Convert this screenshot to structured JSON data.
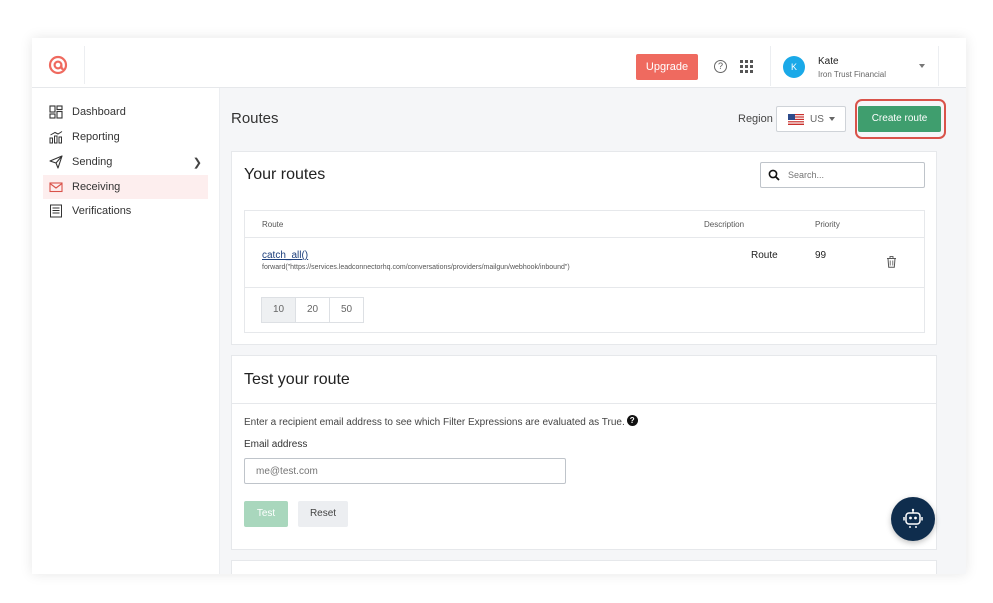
{
  "header": {
    "upgrade_label": "Upgrade",
    "help_icon": "question-circle-icon",
    "apps_icon": "grid-icon",
    "user": {
      "initial": "K",
      "name": "Kate",
      "org": "Iron Trust Financial"
    }
  },
  "sidebar": {
    "items": [
      {
        "label": "Dashboard",
        "icon": "dashboard-icon"
      },
      {
        "label": "Reporting",
        "icon": "chart-icon"
      },
      {
        "label": "Sending",
        "icon": "send-icon",
        "has_submenu": true
      },
      {
        "label": "Receiving",
        "icon": "mail-icon",
        "active": true
      },
      {
        "label": "Verifications",
        "icon": "list-icon"
      }
    ]
  },
  "page": {
    "title": "Routes",
    "region_label": "Region",
    "region_value": "US",
    "create_label": "Create route"
  },
  "routes_card": {
    "title": "Your routes",
    "search_placeholder": "Search...",
    "columns": [
      "Route",
      "Description",
      "Priority"
    ],
    "rows": [
      {
        "expression": "catch_all()",
        "action": "forward(\"https://services.leadconnectorhq.com/conversations/providers/mailgun/webhook/inbound\")",
        "description": "Route",
        "priority": "99"
      }
    ],
    "page_sizes": [
      "10",
      "20",
      "50"
    ]
  },
  "test_card": {
    "title": "Test your route",
    "description": "Enter a recipient email address to see which Filter Expressions are evaluated as True.",
    "info_glyph": "?",
    "email_label": "Email address",
    "email_placeholder": "me@test.com",
    "test_label": "Test",
    "reset_label": "Reset"
  },
  "colors": {
    "brand": "#ef6a5f",
    "primary_green": "#3f9e6e",
    "highlight_red": "#d9534a",
    "active_nav_bg": "#fdeeee"
  }
}
